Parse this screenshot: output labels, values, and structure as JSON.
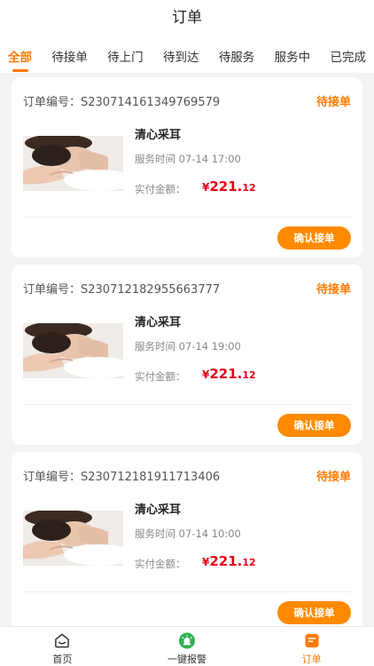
{
  "header": {
    "title": "订单"
  },
  "tabs": [
    {
      "label": "全部",
      "active": true
    },
    {
      "label": "待接单",
      "active": false
    },
    {
      "label": "待上门",
      "active": false
    },
    {
      "label": "待到达",
      "active": false
    },
    {
      "label": "待服务",
      "active": false
    },
    {
      "label": "服务中",
      "active": false
    },
    {
      "label": "已完成",
      "active": false
    }
  ],
  "orders": [
    {
      "order_no": "订单编号：S230714161349769579",
      "status": "待接单",
      "service_name": "清心采耳",
      "service_time": "服务时间   07-14 17:00",
      "pay_label": "实付金额：",
      "price_symbol": "¥",
      "price_int": "221.",
      "price_dec": "12",
      "action_label": "确认接单"
    },
    {
      "order_no": "订单编号：S230712182955663777",
      "status": "待接单",
      "service_name": "清心采耳",
      "service_time": "服务时间   07-14 19:00",
      "pay_label": "实付金额：",
      "price_symbol": "¥",
      "price_int": "221.",
      "price_dec": "12",
      "action_label": "确认接单"
    },
    {
      "order_no": "订单编号：S230712181911713406",
      "status": "待接单",
      "service_name": "清心采耳",
      "service_time": "服务时间   07-14 10:00",
      "pay_label": "实付金额：",
      "price_symbol": "¥",
      "price_int": "221.",
      "price_dec": "12",
      "action_label": "确认接单"
    }
  ],
  "tabbar": [
    {
      "label": "首页",
      "icon": "home-icon",
      "active": false
    },
    {
      "label": "一键报警",
      "icon": "alarm-icon",
      "active": false
    },
    {
      "label": "订单",
      "icon": "order-icon",
      "active": true
    }
  ],
  "colors": {
    "accent": "#ff7a00",
    "button": "#ff8a00",
    "price": "#e60012",
    "alarm": "#2fb24c"
  }
}
